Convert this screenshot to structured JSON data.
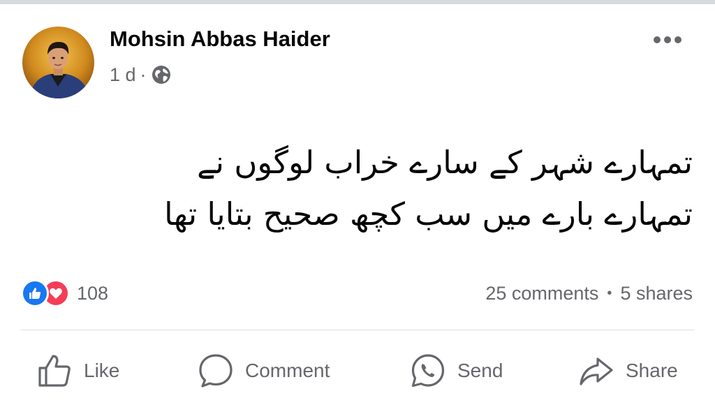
{
  "post": {
    "author": "Mohsin Abbas Haider",
    "time": "1 d",
    "meta_separator": "·",
    "privacy_icon": "globe-icon",
    "text_lines": [
      "تمہارے شہر کے سارے خراب لوگوں نے",
      "تمہارے بارے میں سب کچھ صحیح بتایا تھا"
    ]
  },
  "reactions": {
    "icons": [
      "like-reaction-icon",
      "love-reaction-icon"
    ],
    "count": "108"
  },
  "stats": {
    "comments": "25 comments",
    "separator": "•",
    "shares": "5 shares"
  },
  "actions": {
    "like": "Like",
    "comment": "Comment",
    "send": "Send",
    "share": "Share"
  },
  "colors": {
    "like_blue": "#1877f2",
    "love_red": "#f33e58",
    "secondary_text": "#65676b",
    "primary_text": "#050505"
  }
}
